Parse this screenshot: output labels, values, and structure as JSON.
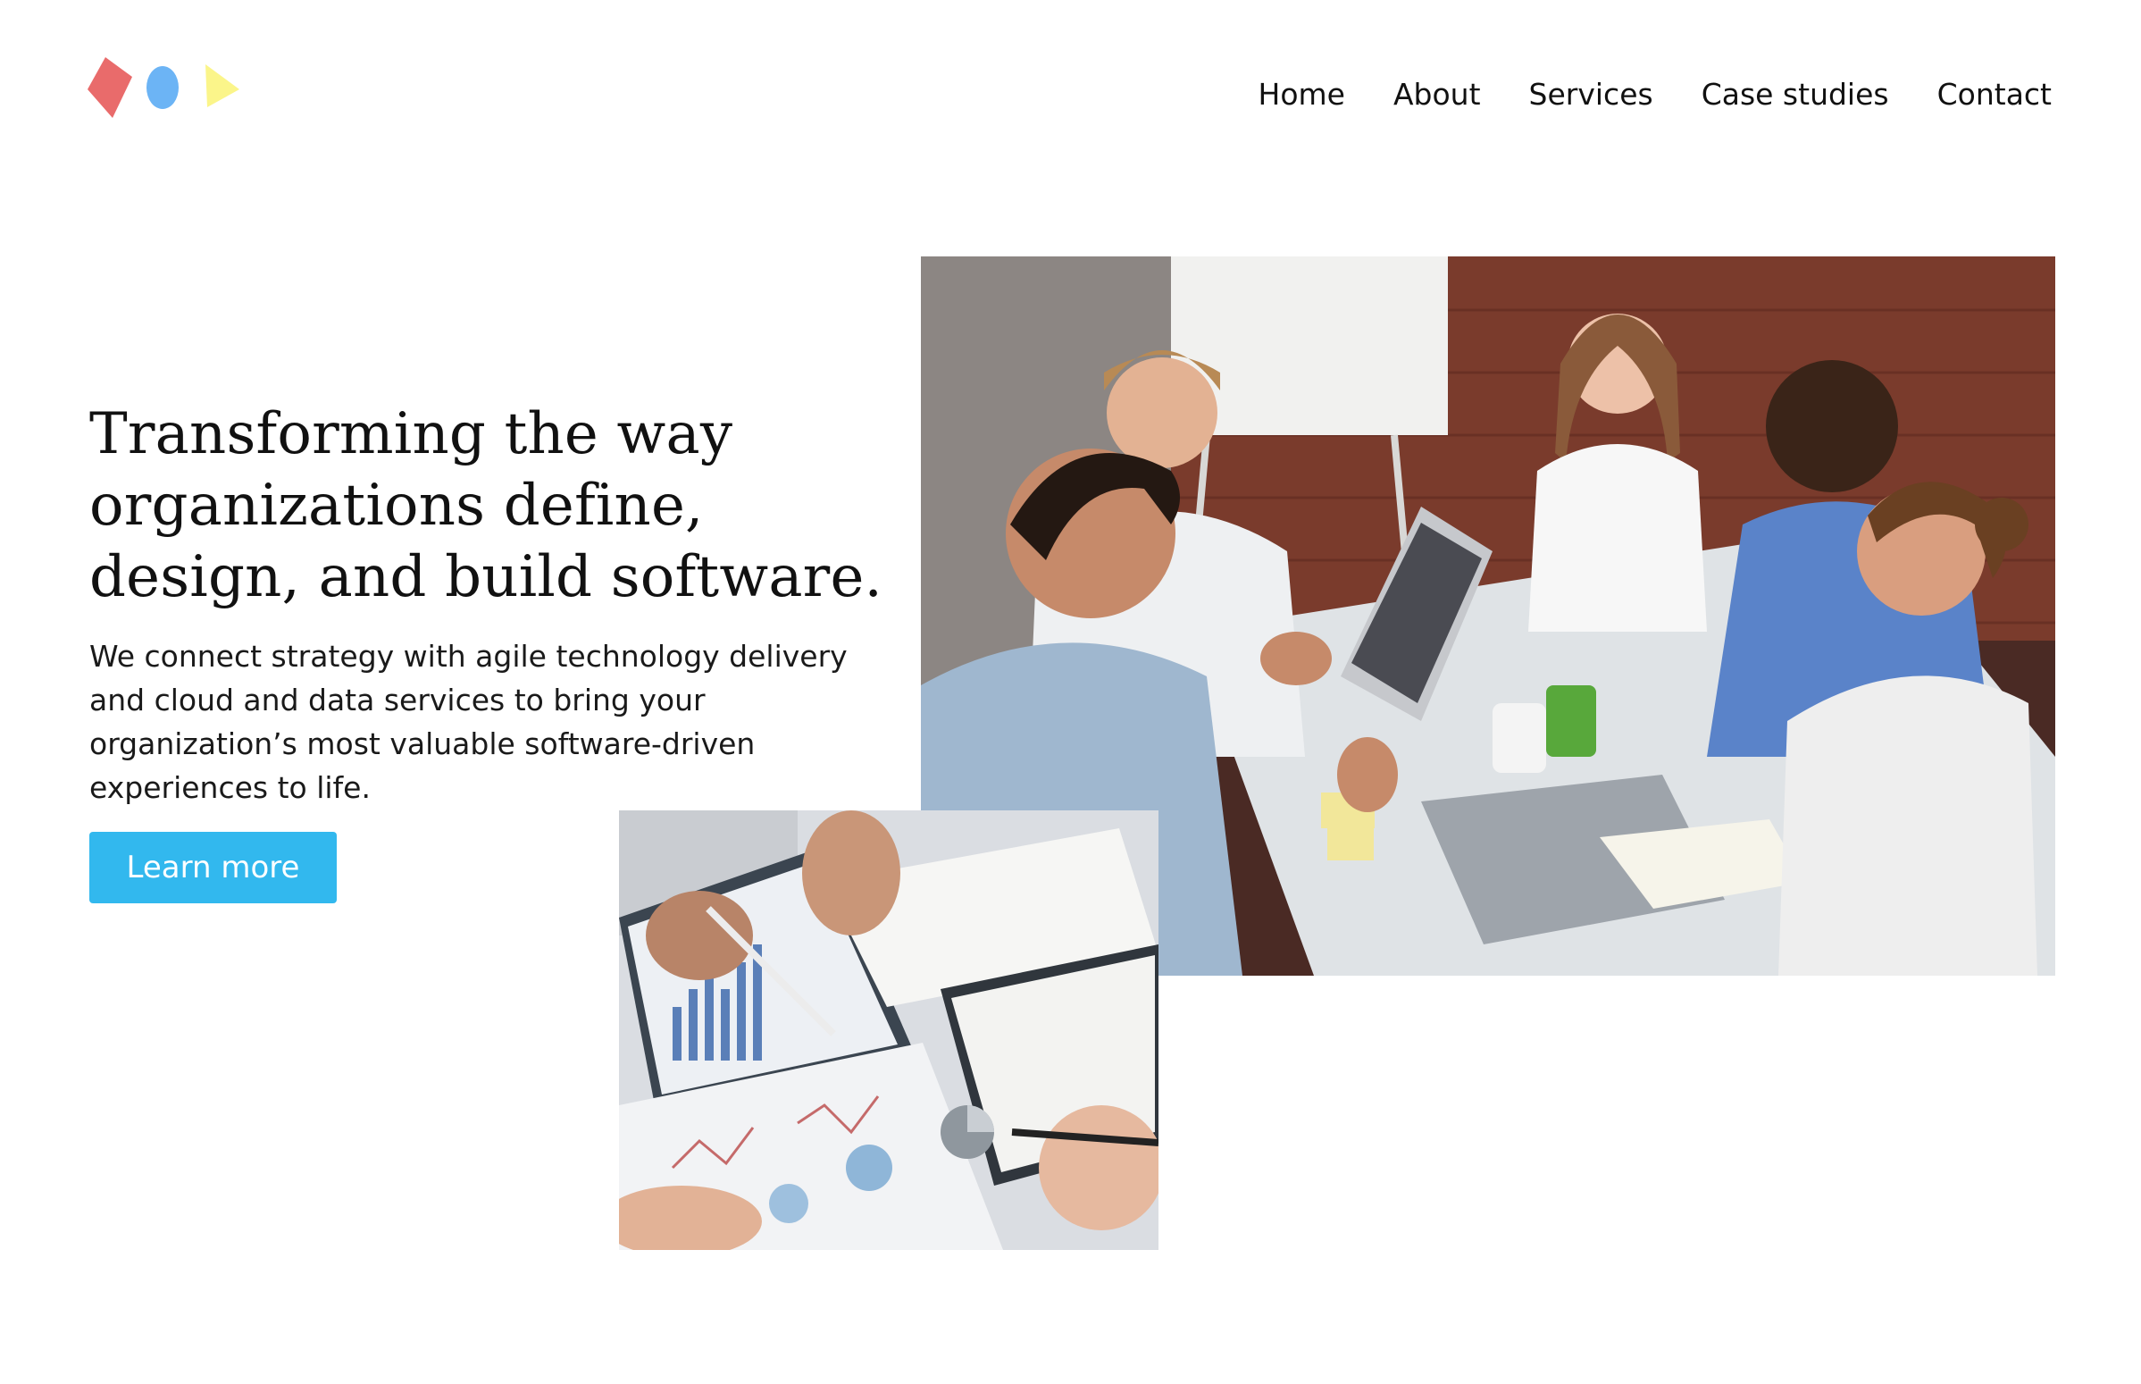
{
  "nav": {
    "items": [
      {
        "label": "Home"
      },
      {
        "label": "About"
      },
      {
        "label": "Services"
      },
      {
        "label": "Case studies"
      },
      {
        "label": "Contact"
      }
    ]
  },
  "hero": {
    "title": "Transforming the way organizations define, design, and build software.",
    "description": "We connect strategy with agile technology delivery and cloud and data services to bring your organization’s most valuable software-driven experiences to life.",
    "cta_label": "Learn more"
  },
  "logo": {
    "shapes": [
      "red-diamond",
      "blue-oval",
      "yellow-triangle"
    ],
    "colors": {
      "red": "#e96b6b",
      "blue": "#6cb4f5",
      "yellow": "#fbf58a"
    }
  },
  "images": {
    "team_meeting": "photo of a team of five people meeting around a table with laptops",
    "documents": "photo of hands reviewing printed charts and reports"
  },
  "colors": {
    "accent": "#32b8ee",
    "text": "#111111",
    "background": "#ffffff"
  }
}
